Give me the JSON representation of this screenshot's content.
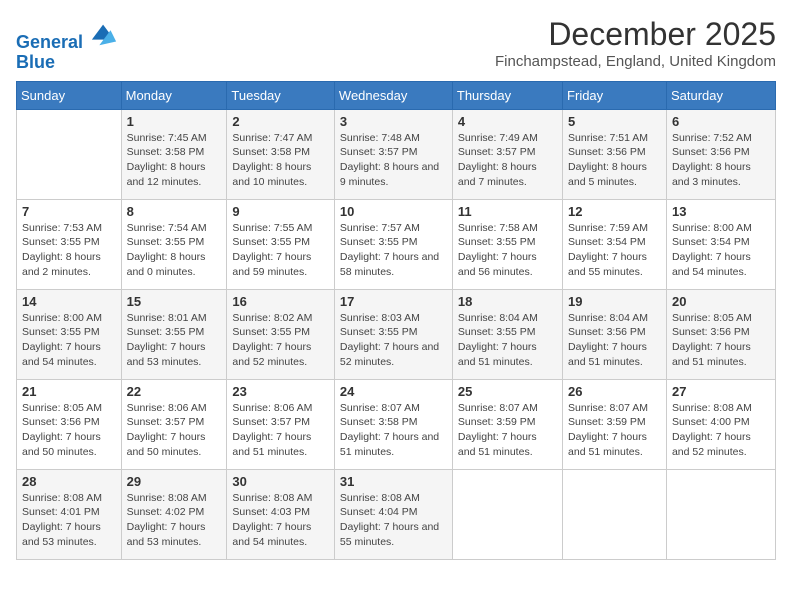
{
  "logo": {
    "line1": "General",
    "line2": "Blue"
  },
  "title": "December 2025",
  "subtitle": "Finchampstead, England, United Kingdom",
  "days_header": [
    "Sunday",
    "Monday",
    "Tuesday",
    "Wednesday",
    "Thursday",
    "Friday",
    "Saturday"
  ],
  "weeks": [
    [
      {
        "num": "",
        "sunrise": "",
        "sunset": "",
        "daylight": ""
      },
      {
        "num": "1",
        "sunrise": "Sunrise: 7:45 AM",
        "sunset": "Sunset: 3:58 PM",
        "daylight": "Daylight: 8 hours and 12 minutes."
      },
      {
        "num": "2",
        "sunrise": "Sunrise: 7:47 AM",
        "sunset": "Sunset: 3:58 PM",
        "daylight": "Daylight: 8 hours and 10 minutes."
      },
      {
        "num": "3",
        "sunrise": "Sunrise: 7:48 AM",
        "sunset": "Sunset: 3:57 PM",
        "daylight": "Daylight: 8 hours and 9 minutes."
      },
      {
        "num": "4",
        "sunrise": "Sunrise: 7:49 AM",
        "sunset": "Sunset: 3:57 PM",
        "daylight": "Daylight: 8 hours and 7 minutes."
      },
      {
        "num": "5",
        "sunrise": "Sunrise: 7:51 AM",
        "sunset": "Sunset: 3:56 PM",
        "daylight": "Daylight: 8 hours and 5 minutes."
      },
      {
        "num": "6",
        "sunrise": "Sunrise: 7:52 AM",
        "sunset": "Sunset: 3:56 PM",
        "daylight": "Daylight: 8 hours and 3 minutes."
      }
    ],
    [
      {
        "num": "7",
        "sunrise": "Sunrise: 7:53 AM",
        "sunset": "Sunset: 3:55 PM",
        "daylight": "Daylight: 8 hours and 2 minutes."
      },
      {
        "num": "8",
        "sunrise": "Sunrise: 7:54 AM",
        "sunset": "Sunset: 3:55 PM",
        "daylight": "Daylight: 8 hours and 0 minutes."
      },
      {
        "num": "9",
        "sunrise": "Sunrise: 7:55 AM",
        "sunset": "Sunset: 3:55 PM",
        "daylight": "Daylight: 7 hours and 59 minutes."
      },
      {
        "num": "10",
        "sunrise": "Sunrise: 7:57 AM",
        "sunset": "Sunset: 3:55 PM",
        "daylight": "Daylight: 7 hours and 58 minutes."
      },
      {
        "num": "11",
        "sunrise": "Sunrise: 7:58 AM",
        "sunset": "Sunset: 3:55 PM",
        "daylight": "Daylight: 7 hours and 56 minutes."
      },
      {
        "num": "12",
        "sunrise": "Sunrise: 7:59 AM",
        "sunset": "Sunset: 3:54 PM",
        "daylight": "Daylight: 7 hours and 55 minutes."
      },
      {
        "num": "13",
        "sunrise": "Sunrise: 8:00 AM",
        "sunset": "Sunset: 3:54 PM",
        "daylight": "Daylight: 7 hours and 54 minutes."
      }
    ],
    [
      {
        "num": "14",
        "sunrise": "Sunrise: 8:00 AM",
        "sunset": "Sunset: 3:55 PM",
        "daylight": "Daylight: 7 hours and 54 minutes."
      },
      {
        "num": "15",
        "sunrise": "Sunrise: 8:01 AM",
        "sunset": "Sunset: 3:55 PM",
        "daylight": "Daylight: 7 hours and 53 minutes."
      },
      {
        "num": "16",
        "sunrise": "Sunrise: 8:02 AM",
        "sunset": "Sunset: 3:55 PM",
        "daylight": "Daylight: 7 hours and 52 minutes."
      },
      {
        "num": "17",
        "sunrise": "Sunrise: 8:03 AM",
        "sunset": "Sunset: 3:55 PM",
        "daylight": "Daylight: 7 hours and 52 minutes."
      },
      {
        "num": "18",
        "sunrise": "Sunrise: 8:04 AM",
        "sunset": "Sunset: 3:55 PM",
        "daylight": "Daylight: 7 hours and 51 minutes."
      },
      {
        "num": "19",
        "sunrise": "Sunrise: 8:04 AM",
        "sunset": "Sunset: 3:56 PM",
        "daylight": "Daylight: 7 hours and 51 minutes."
      },
      {
        "num": "20",
        "sunrise": "Sunrise: 8:05 AM",
        "sunset": "Sunset: 3:56 PM",
        "daylight": "Daylight: 7 hours and 51 minutes."
      }
    ],
    [
      {
        "num": "21",
        "sunrise": "Sunrise: 8:05 AM",
        "sunset": "Sunset: 3:56 PM",
        "daylight": "Daylight: 7 hours and 50 minutes."
      },
      {
        "num": "22",
        "sunrise": "Sunrise: 8:06 AM",
        "sunset": "Sunset: 3:57 PM",
        "daylight": "Daylight: 7 hours and 50 minutes."
      },
      {
        "num": "23",
        "sunrise": "Sunrise: 8:06 AM",
        "sunset": "Sunset: 3:57 PM",
        "daylight": "Daylight: 7 hours and 51 minutes."
      },
      {
        "num": "24",
        "sunrise": "Sunrise: 8:07 AM",
        "sunset": "Sunset: 3:58 PM",
        "daylight": "Daylight: 7 hours and 51 minutes."
      },
      {
        "num": "25",
        "sunrise": "Sunrise: 8:07 AM",
        "sunset": "Sunset: 3:59 PM",
        "daylight": "Daylight: 7 hours and 51 minutes."
      },
      {
        "num": "26",
        "sunrise": "Sunrise: 8:07 AM",
        "sunset": "Sunset: 3:59 PM",
        "daylight": "Daylight: 7 hours and 51 minutes."
      },
      {
        "num": "27",
        "sunrise": "Sunrise: 8:08 AM",
        "sunset": "Sunset: 4:00 PM",
        "daylight": "Daylight: 7 hours and 52 minutes."
      }
    ],
    [
      {
        "num": "28",
        "sunrise": "Sunrise: 8:08 AM",
        "sunset": "Sunset: 4:01 PM",
        "daylight": "Daylight: 7 hours and 53 minutes."
      },
      {
        "num": "29",
        "sunrise": "Sunrise: 8:08 AM",
        "sunset": "Sunset: 4:02 PM",
        "daylight": "Daylight: 7 hours and 53 minutes."
      },
      {
        "num": "30",
        "sunrise": "Sunrise: 8:08 AM",
        "sunset": "Sunset: 4:03 PM",
        "daylight": "Daylight: 7 hours and 54 minutes."
      },
      {
        "num": "31",
        "sunrise": "Sunrise: 8:08 AM",
        "sunset": "Sunset: 4:04 PM",
        "daylight": "Daylight: 7 hours and 55 minutes."
      },
      {
        "num": "",
        "sunrise": "",
        "sunset": "",
        "daylight": ""
      },
      {
        "num": "",
        "sunrise": "",
        "sunset": "",
        "daylight": ""
      },
      {
        "num": "",
        "sunrise": "",
        "sunset": "",
        "daylight": ""
      }
    ]
  ]
}
